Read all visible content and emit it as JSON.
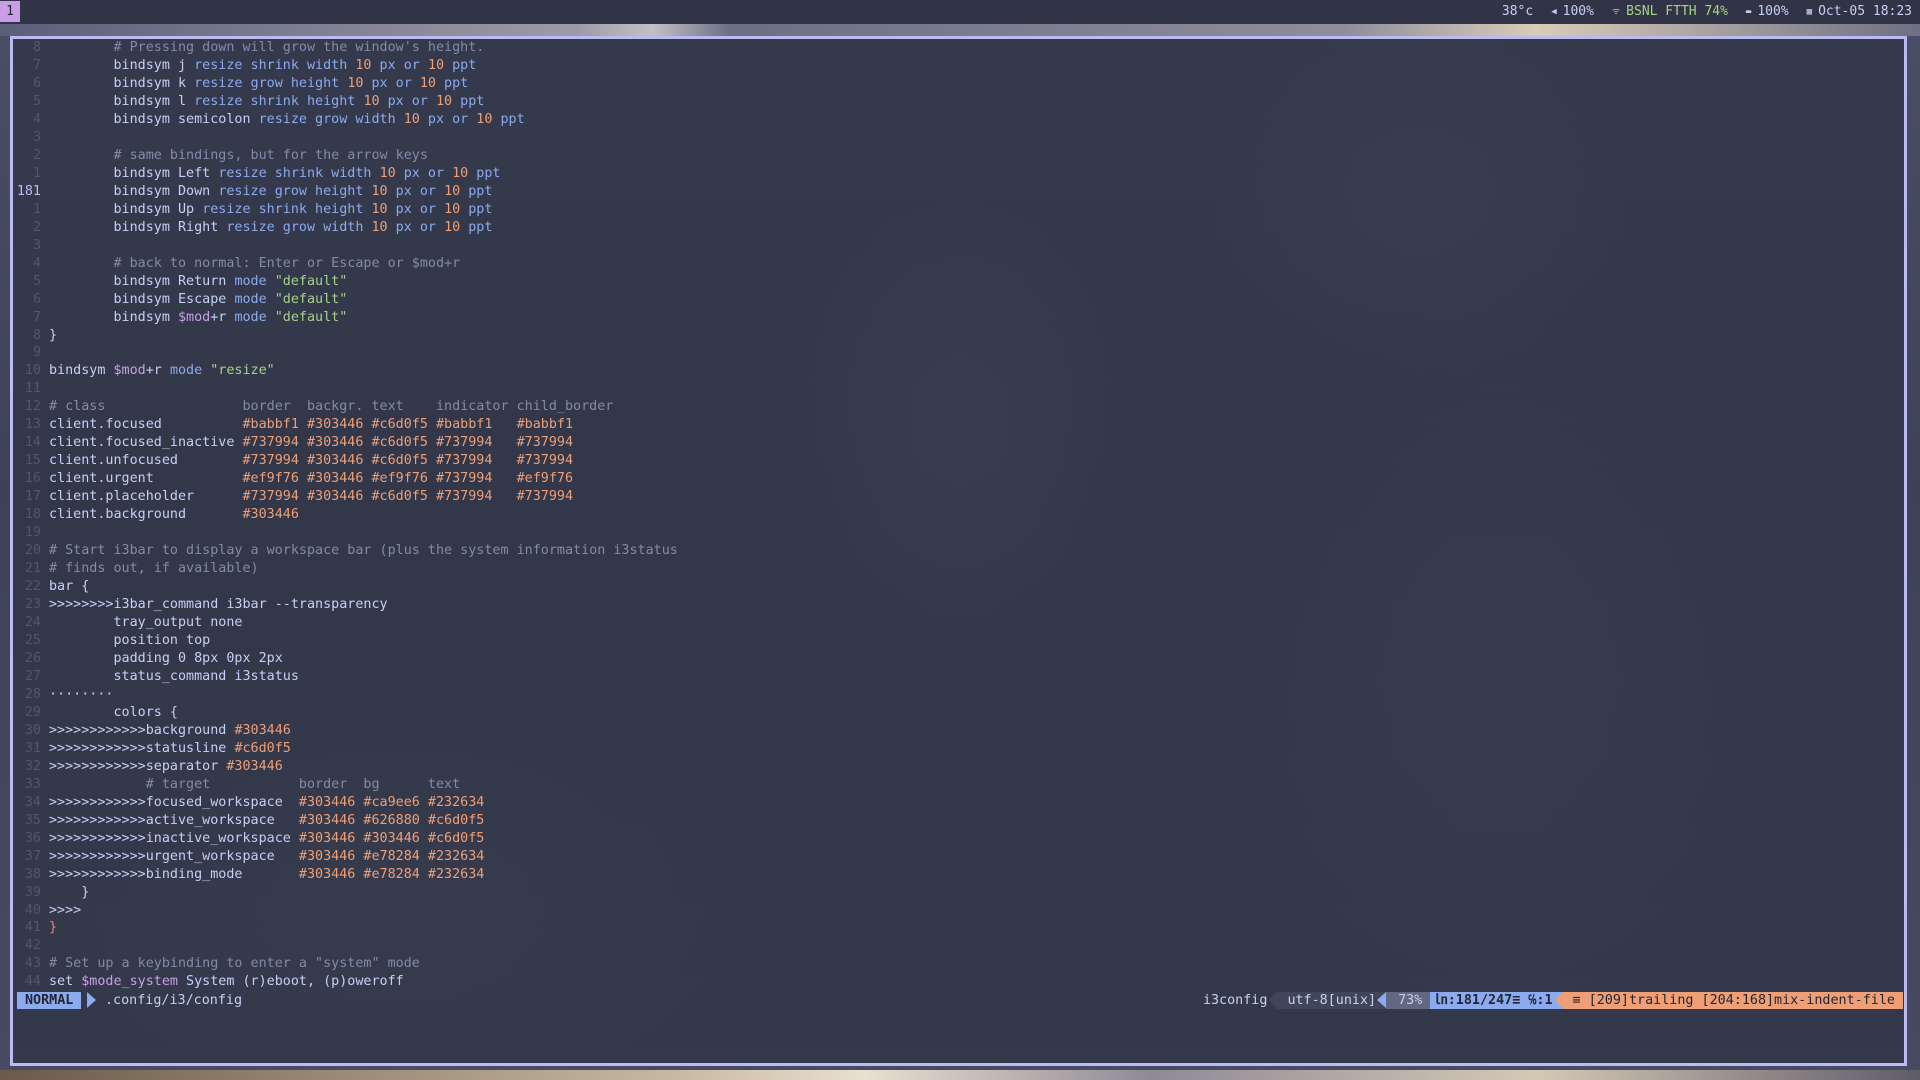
{
  "topbar": {
    "workspace": "1",
    "status": {
      "temperature": "38°c",
      "volume": "100%",
      "network": "BSNL FTTH 74%",
      "battery": "100%",
      "datetime": "Oct-05 18:23"
    }
  },
  "editor": {
    "lines": [
      {
        "num": "8",
        "seg": [
          {
            "c": "",
            "t": "        "
          },
          {
            "c": "cm",
            "t": "# Pressing down will grow the window's height."
          }
        ]
      },
      {
        "num": "7",
        "seg": [
          {
            "c": "",
            "t": "        bindsym j "
          },
          {
            "c": "kw",
            "t": "resize shrink width "
          },
          {
            "c": "nm",
            "t": "10"
          },
          {
            "c": "kw",
            "t": " px or "
          },
          {
            "c": "nm",
            "t": "10"
          },
          {
            "c": "kw",
            "t": " ppt"
          }
        ]
      },
      {
        "num": "6",
        "seg": [
          {
            "c": "",
            "t": "        bindsym k "
          },
          {
            "c": "kw",
            "t": "resize grow height "
          },
          {
            "c": "nm",
            "t": "10"
          },
          {
            "c": "kw",
            "t": " px or "
          },
          {
            "c": "nm",
            "t": "10"
          },
          {
            "c": "kw",
            "t": " ppt"
          }
        ]
      },
      {
        "num": "5",
        "seg": [
          {
            "c": "",
            "t": "        bindsym l "
          },
          {
            "c": "kw",
            "t": "resize shrink height "
          },
          {
            "c": "nm",
            "t": "10"
          },
          {
            "c": "kw",
            "t": " px or "
          },
          {
            "c": "nm",
            "t": "10"
          },
          {
            "c": "kw",
            "t": " ppt"
          }
        ]
      },
      {
        "num": "4",
        "seg": [
          {
            "c": "",
            "t": "        bindsym semicolon "
          },
          {
            "c": "kw",
            "t": "resize grow width "
          },
          {
            "c": "nm",
            "t": "10"
          },
          {
            "c": "kw",
            "t": " px or "
          },
          {
            "c": "nm",
            "t": "10"
          },
          {
            "c": "kw",
            "t": " ppt"
          }
        ]
      },
      {
        "num": "3",
        "seg": []
      },
      {
        "num": "2",
        "seg": [
          {
            "c": "",
            "t": "        "
          },
          {
            "c": "cm",
            "t": "# same bindings, but for the arrow keys"
          }
        ]
      },
      {
        "num": "1",
        "seg": [
          {
            "c": "",
            "t": "        bindsym Left "
          },
          {
            "c": "kw",
            "t": "resize shrink width "
          },
          {
            "c": "nm",
            "t": "10"
          },
          {
            "c": "kw",
            "t": " px or "
          },
          {
            "c": "nm",
            "t": "10"
          },
          {
            "c": "kw",
            "t": " ppt"
          }
        ]
      },
      {
        "num": "181",
        "cur": true,
        "seg": [
          {
            "c": "",
            "t": "        bindsym Down "
          },
          {
            "c": "kw",
            "t": "resize grow height "
          },
          {
            "c": "nm",
            "t": "10"
          },
          {
            "c": "kw",
            "t": " px or "
          },
          {
            "c": "nm",
            "t": "10"
          },
          {
            "c": "kw",
            "t": " ppt"
          }
        ]
      },
      {
        "num": "1",
        "seg": [
          {
            "c": "",
            "t": "        bindsym Up "
          },
          {
            "c": "kw",
            "t": "resize shrink height "
          },
          {
            "c": "nm",
            "t": "10"
          },
          {
            "c": "kw",
            "t": " px or "
          },
          {
            "c": "nm",
            "t": "10"
          },
          {
            "c": "kw",
            "t": " ppt"
          }
        ]
      },
      {
        "num": "2",
        "seg": [
          {
            "c": "",
            "t": "        bindsym Right "
          },
          {
            "c": "kw",
            "t": "resize grow width "
          },
          {
            "c": "nm",
            "t": "10"
          },
          {
            "c": "kw",
            "t": " px or "
          },
          {
            "c": "nm",
            "t": "10"
          },
          {
            "c": "kw",
            "t": " ppt"
          }
        ]
      },
      {
        "num": "3",
        "seg": []
      },
      {
        "num": "4",
        "seg": [
          {
            "c": "",
            "t": "        "
          },
          {
            "c": "cm",
            "t": "# back to normal: Enter or Escape or $mod+r"
          }
        ]
      },
      {
        "num": "5",
        "seg": [
          {
            "c": "",
            "t": "        bindsym Return "
          },
          {
            "c": "kw",
            "t": "mode "
          },
          {
            "c": "st",
            "t": "\"default\""
          }
        ]
      },
      {
        "num": "6",
        "seg": [
          {
            "c": "",
            "t": "        bindsym Escape "
          },
          {
            "c": "kw",
            "t": "mode "
          },
          {
            "c": "st",
            "t": "\"default\""
          }
        ]
      },
      {
        "num": "7",
        "seg": [
          {
            "c": "",
            "t": "        bindsym "
          },
          {
            "c": "vr",
            "t": "$mod"
          },
          {
            "c": "",
            "t": "+r "
          },
          {
            "c": "kw",
            "t": "mode "
          },
          {
            "c": "st",
            "t": "\"default\""
          }
        ]
      },
      {
        "num": "8",
        "seg": [
          {
            "c": "",
            "t": "}"
          }
        ]
      },
      {
        "num": "9",
        "seg": []
      },
      {
        "num": "10",
        "seg": [
          {
            "c": "",
            "t": "bindsym "
          },
          {
            "c": "vr",
            "t": "$mod"
          },
          {
            "c": "",
            "t": "+r "
          },
          {
            "c": "kw",
            "t": "mode "
          },
          {
            "c": "st",
            "t": "\"resize\""
          }
        ]
      },
      {
        "num": "11",
        "seg": []
      },
      {
        "num": "12",
        "seg": [
          {
            "c": "cm",
            "t": "# class                 border  backgr. text    indicator child_border"
          }
        ]
      },
      {
        "num": "13",
        "seg": [
          {
            "c": "",
            "t": "client.focused          "
          },
          {
            "c": "nm",
            "t": "#babbf1"
          },
          {
            "c": "",
            "t": " "
          },
          {
            "c": "nm",
            "t": "#303446"
          },
          {
            "c": "",
            "t": " "
          },
          {
            "c": "nm",
            "t": "#c6d0f5"
          },
          {
            "c": "",
            "t": " "
          },
          {
            "c": "nm",
            "t": "#babbf1"
          },
          {
            "c": "",
            "t": "   "
          },
          {
            "c": "nm",
            "t": "#babbf1"
          }
        ]
      },
      {
        "num": "14",
        "seg": [
          {
            "c": "",
            "t": "client.focused_inactive "
          },
          {
            "c": "nm",
            "t": "#737994"
          },
          {
            "c": "",
            "t": " "
          },
          {
            "c": "nm",
            "t": "#303446"
          },
          {
            "c": "",
            "t": " "
          },
          {
            "c": "nm",
            "t": "#c6d0f5"
          },
          {
            "c": "",
            "t": " "
          },
          {
            "c": "nm",
            "t": "#737994"
          },
          {
            "c": "",
            "t": "   "
          },
          {
            "c": "nm",
            "t": "#737994"
          }
        ]
      },
      {
        "num": "15",
        "seg": [
          {
            "c": "",
            "t": "client.unfocused        "
          },
          {
            "c": "nm",
            "t": "#737994"
          },
          {
            "c": "",
            "t": " "
          },
          {
            "c": "nm",
            "t": "#303446"
          },
          {
            "c": "",
            "t": " "
          },
          {
            "c": "nm",
            "t": "#c6d0f5"
          },
          {
            "c": "",
            "t": " "
          },
          {
            "c": "nm",
            "t": "#737994"
          },
          {
            "c": "",
            "t": "   "
          },
          {
            "c": "nm",
            "t": "#737994"
          }
        ]
      },
      {
        "num": "16",
        "seg": [
          {
            "c": "",
            "t": "client.urgent           "
          },
          {
            "c": "nm",
            "t": "#ef9f76"
          },
          {
            "c": "",
            "t": " "
          },
          {
            "c": "nm",
            "t": "#303446"
          },
          {
            "c": "",
            "t": " "
          },
          {
            "c": "nm",
            "t": "#ef9f76"
          },
          {
            "c": "",
            "t": " "
          },
          {
            "c": "nm",
            "t": "#737994"
          },
          {
            "c": "",
            "t": "   "
          },
          {
            "c": "nm",
            "t": "#ef9f76"
          }
        ]
      },
      {
        "num": "17",
        "seg": [
          {
            "c": "",
            "t": "client.placeholder      "
          },
          {
            "c": "nm",
            "t": "#737994"
          },
          {
            "c": "",
            "t": " "
          },
          {
            "c": "nm",
            "t": "#303446"
          },
          {
            "c": "",
            "t": " "
          },
          {
            "c": "nm",
            "t": "#c6d0f5"
          },
          {
            "c": "",
            "t": " "
          },
          {
            "c": "nm",
            "t": "#737994"
          },
          {
            "c": "",
            "t": "   "
          },
          {
            "c": "nm",
            "t": "#737994"
          }
        ]
      },
      {
        "num": "18",
        "seg": [
          {
            "c": "",
            "t": "client.background       "
          },
          {
            "c": "nm",
            "t": "#303446"
          }
        ]
      },
      {
        "num": "19",
        "seg": []
      },
      {
        "num": "20",
        "seg": [
          {
            "c": "cm",
            "t": "# Start i3bar to display a workspace bar (plus the system information i3status"
          }
        ]
      },
      {
        "num": "21",
        "seg": [
          {
            "c": "cm",
            "t": "# finds out, if available)"
          }
        ]
      },
      {
        "num": "22",
        "seg": [
          {
            "c": "",
            "t": "bar {"
          }
        ]
      },
      {
        "num": "23",
        "seg": [
          {
            "c": "",
            "t": ">>>>>>>>i3bar_command i3bar --transparency"
          }
        ]
      },
      {
        "num": "24",
        "seg": [
          {
            "c": "",
            "t": "        tray_output none"
          }
        ]
      },
      {
        "num": "25",
        "seg": [
          {
            "c": "",
            "t": "        position top"
          }
        ]
      },
      {
        "num": "26",
        "seg": [
          {
            "c": "",
            "t": "        padding 0 8px 0px 2px"
          }
        ]
      },
      {
        "num": "27",
        "seg": [
          {
            "c": "",
            "t": "        status_command i3status"
          }
        ]
      },
      {
        "num": "28",
        "seg": [
          {
            "c": "",
            "t": "········"
          }
        ]
      },
      {
        "num": "29",
        "seg": [
          {
            "c": "",
            "t": "        colors {"
          }
        ]
      },
      {
        "num": "30",
        "seg": [
          {
            "c": "",
            "t": ">>>>>>>>>>>>background "
          },
          {
            "c": "nm",
            "t": "#303446"
          }
        ]
      },
      {
        "num": "31",
        "seg": [
          {
            "c": "",
            "t": ">>>>>>>>>>>>statusline "
          },
          {
            "c": "nm",
            "t": "#c6d0f5"
          }
        ]
      },
      {
        "num": "32",
        "seg": [
          {
            "c": "",
            "t": ">>>>>>>>>>>>separator "
          },
          {
            "c": "nm",
            "t": "#303446"
          }
        ]
      },
      {
        "num": "33",
        "seg": [
          {
            "c": "",
            "t": "            "
          },
          {
            "c": "cm",
            "t": "# target           border  bg      text"
          }
        ]
      },
      {
        "num": "34",
        "seg": [
          {
            "c": "",
            "t": ">>>>>>>>>>>>focused_workspace  "
          },
          {
            "c": "nm",
            "t": "#303446"
          },
          {
            "c": "",
            "t": " "
          },
          {
            "c": "nm",
            "t": "#ca9ee6"
          },
          {
            "c": "",
            "t": " "
          },
          {
            "c": "nm",
            "t": "#232634"
          }
        ]
      },
      {
        "num": "35",
        "seg": [
          {
            "c": "",
            "t": ">>>>>>>>>>>>active_workspace   "
          },
          {
            "c": "nm",
            "t": "#303446"
          },
          {
            "c": "",
            "t": " "
          },
          {
            "c": "nm",
            "t": "#626880"
          },
          {
            "c": "",
            "t": " "
          },
          {
            "c": "nm",
            "t": "#c6d0f5"
          }
        ]
      },
      {
        "num": "36",
        "seg": [
          {
            "c": "",
            "t": ">>>>>>>>>>>>inactive_workspace "
          },
          {
            "c": "nm",
            "t": "#303446"
          },
          {
            "c": "",
            "t": " "
          },
          {
            "c": "nm",
            "t": "#303446"
          },
          {
            "c": "",
            "t": " "
          },
          {
            "c": "nm",
            "t": "#c6d0f5"
          }
        ]
      },
      {
        "num": "37",
        "seg": [
          {
            "c": "",
            "t": ">>>>>>>>>>>>urgent_workspace   "
          },
          {
            "c": "nm",
            "t": "#303446"
          },
          {
            "c": "",
            "t": " "
          },
          {
            "c": "nm",
            "t": "#e78284"
          },
          {
            "c": "",
            "t": " "
          },
          {
            "c": "nm",
            "t": "#232634"
          }
        ]
      },
      {
        "num": "38",
        "seg": [
          {
            "c": "",
            "t": ">>>>>>>>>>>>binding_mode       "
          },
          {
            "c": "nm",
            "t": "#303446"
          },
          {
            "c": "",
            "t": " "
          },
          {
            "c": "nm",
            "t": "#e78284"
          },
          {
            "c": "",
            "t": " "
          },
          {
            "c": "nm",
            "t": "#232634"
          }
        ]
      },
      {
        "num": "39",
        "seg": [
          {
            "c": "",
            "t": "    }"
          }
        ]
      },
      {
        "num": "40",
        "seg": [
          {
            "c": "",
            "t": ">>>>"
          }
        ]
      },
      {
        "num": "41",
        "seg": [
          {
            "c": "br",
            "t": "}"
          }
        ]
      },
      {
        "num": "42",
        "seg": []
      },
      {
        "num": "43",
        "seg": [
          {
            "c": "cm",
            "t": "# Set up a keybinding to enter a \"system\" mode"
          }
        ]
      },
      {
        "num": "44",
        "seg": [
          {
            "c": "",
            "t": "set "
          },
          {
            "c": "vr",
            "t": "$mode_system"
          },
          {
            "c": "",
            "t": " System (r)eboot, (p)oweroff"
          }
        ]
      }
    ]
  },
  "statusline": {
    "mode": "NORMAL",
    "filepath": ".config/i3/config",
    "filetype": "i3config",
    "encoding": "utf-8[unix]",
    "percent": "73%",
    "position": "㏑:181/247≡ ℅:1",
    "warning": "≡ [209]trailing [204:168]mix-indent-file"
  },
  "colors": {
    "bar_bg": "#303446",
    "workspace_focused": "#ca9ee6",
    "border_focused": "#babbf1",
    "mode_normal": "#8caaee",
    "warning": "#ef9f76"
  }
}
